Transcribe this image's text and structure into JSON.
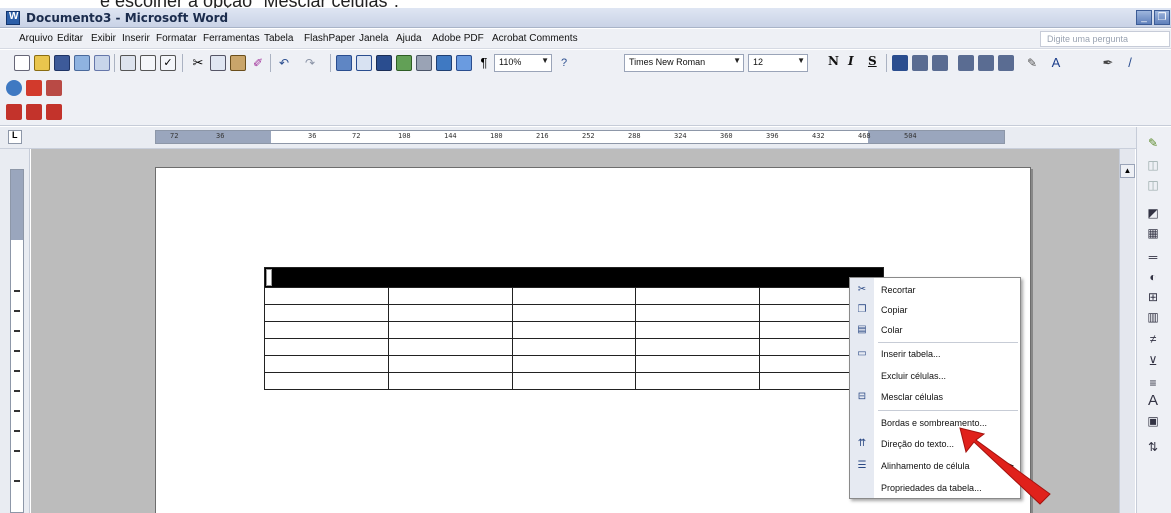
{
  "caption": "e escolher a opção \"Mesclar células\".",
  "window": {
    "title": "Documento3 - Microsoft Word"
  },
  "menubar": {
    "items": [
      "Arquivo",
      "Editar",
      "Exibir",
      "Inserir",
      "Formatar",
      "Ferramentas",
      "Tabela",
      "FlashPaper",
      "Janela",
      "Ajuda",
      "Adobe PDF",
      "Acrobat Comments"
    ],
    "help_placeholder": "Digite uma pergunta"
  },
  "toolbar": {
    "zoom": "110%",
    "font": "Times New Roman",
    "size": "12",
    "bold": "N",
    "italic": "I",
    "underline": "S"
  },
  "ruler": {
    "ticks": [
      "72",
      "36",
      "36",
      "72",
      "108",
      "144",
      "180",
      "216",
      "252",
      "288",
      "324",
      "360",
      "396",
      "432",
      "468",
      "504"
    ]
  },
  "table": {
    "rows": 7,
    "cols": 5
  },
  "context_menu": {
    "items": [
      {
        "label": "Recortar",
        "icon": "scissors-icon",
        "glyph": "✂"
      },
      {
        "label": "Copiar",
        "icon": "copy-icon",
        "glyph": "❐"
      },
      {
        "label": "Colar",
        "icon": "paste-icon",
        "glyph": "▤"
      },
      {
        "label": "Inserir tabela...",
        "icon": "insert-table-icon",
        "glyph": "▭"
      },
      {
        "label": "Excluir células...",
        "icon": "",
        "glyph": ""
      },
      {
        "label": "Mesclar células",
        "icon": "merge-cells-icon",
        "glyph": "⊟"
      },
      {
        "label": "Bordas e sombreamento...",
        "icon": "",
        "glyph": ""
      },
      {
        "label": "Direção do texto...",
        "icon": "text-direction-icon",
        "glyph": "⇈"
      },
      {
        "label": "Alinhamento de célula",
        "icon": "cell-alignment-icon",
        "glyph": "☰"
      },
      {
        "label": "Propriedades da tabela...",
        "icon": "",
        "glyph": ""
      }
    ]
  },
  "colors": {
    "annotation_arrow": "#e0211b",
    "selection": "#000000"
  }
}
